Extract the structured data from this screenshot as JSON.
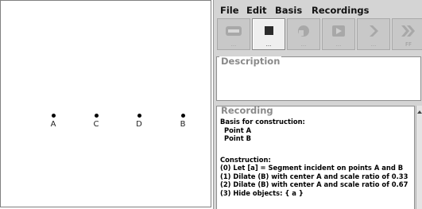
{
  "canvas": {
    "points": [
      {
        "label": "A"
      },
      {
        "label": "C"
      },
      {
        "label": "D"
      },
      {
        "label": "B"
      }
    ]
  },
  "menu": {
    "items": [
      "File",
      "Edit",
      "Basis",
      "Recordings"
    ]
  },
  "toolbar": {
    "buttons": [
      {
        "name": "rewind-button",
        "icon": "rewind-icon",
        "caption": "...",
        "enabled": false
      },
      {
        "name": "stop-button",
        "icon": "stop-icon",
        "caption": "...",
        "enabled": true
      },
      {
        "name": "back-button",
        "icon": "back-icon",
        "caption": "...",
        "enabled": false
      },
      {
        "name": "play-button",
        "icon": "play-icon",
        "caption": "...",
        "enabled": false
      },
      {
        "name": "step-forward-button",
        "icon": "step-forward-icon",
        "caption": "...",
        "enabled": false
      },
      {
        "name": "fast-forward-button",
        "icon": "fast-forward-icon",
        "caption": "FF",
        "enabled": false
      }
    ]
  },
  "description": {
    "legend": "Description",
    "text": ""
  },
  "recording": {
    "legend": "Recording",
    "basis_header": "Basis for construction:",
    "basis_items": [
      "Point A",
      "Point B"
    ],
    "construction_header": "Construction:",
    "steps": [
      "(0)  Let [a] = Segment incident on points A and B",
      "(1)  Dilate (B) with center A  and scale ratio of 0.33",
      "(2)  Dilate (B) with center A  and scale ratio of 0.67",
      "(3) Hide objects: { a }"
    ]
  },
  "colors": {
    "panel": "#d4d4d4",
    "disabled_icon": "#a8a8a8",
    "legend_text": "#8a8a8a"
  }
}
